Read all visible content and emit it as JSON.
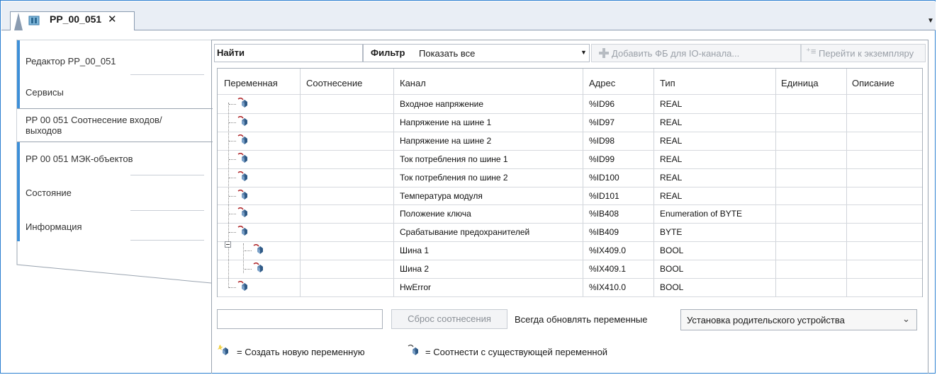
{
  "tab": {
    "title": "PP_00_051",
    "close": "✕"
  },
  "nav": [
    {
      "label": "Редактор PP_00_051"
    },
    {
      "label": "Сервисы"
    },
    {
      "label": "PP 00 051 Соотнесение входов/выходов"
    },
    {
      "label": "PP 00 051 МЭК-объектов"
    },
    {
      "label": "Состояние"
    },
    {
      "label": "Информация"
    }
  ],
  "toolbar": {
    "find_label": "Найти",
    "filter_label": "Фильтр",
    "filter_value": "Показать все",
    "add_fb_label": "Добавить ФБ для IO-канала...",
    "goto_label": "Перейти к экземпляру"
  },
  "table": {
    "columns": [
      "Переменная",
      "Соотнесение",
      "Канал",
      "Адрес",
      "Тип",
      "Единица",
      "Описание"
    ],
    "rows": [
      {
        "channel": "Входное напряжение",
        "address": "%ID96",
        "type": "REAL"
      },
      {
        "channel": "Напряжение на шине 1",
        "address": "%ID97",
        "type": "REAL"
      },
      {
        "channel": "Напряжение на шине 2",
        "address": "%ID98",
        "type": "REAL"
      },
      {
        "channel": "Ток потребления по шине 1",
        "address": "%ID99",
        "type": "REAL"
      },
      {
        "channel": "Ток потребления по шине 2",
        "address": "%ID100",
        "type": "REAL"
      },
      {
        "channel": "Температура модуля",
        "address": "%ID101",
        "type": "REAL"
      },
      {
        "channel": "Положение ключа",
        "address": "%IB408",
        "type": "Enumeration of BYTE"
      },
      {
        "channel": "Срабатывание предохранителей",
        "address": "%IB409",
        "type": "BYTE"
      },
      {
        "channel": "Шина 1",
        "address": "%IX409.0",
        "type": "BOOL"
      },
      {
        "channel": "Шина 2",
        "address": "%IX409.1",
        "type": "BOOL"
      },
      {
        "channel": "HwError",
        "address": "%IX410.0",
        "type": "BOOL"
      }
    ]
  },
  "bottom": {
    "reset_label": "Сброс соотнесения",
    "always_update_label": "Всегда обновлять переменные",
    "update_option": "Установка родительского устройства"
  },
  "legend": {
    "new_var": "= Создать новую переменную",
    "map_existing": "= Соотнести с существующей переменной"
  },
  "colors": {
    "accent": "#3d8fd8",
    "frame": "#2b7fd0"
  }
}
